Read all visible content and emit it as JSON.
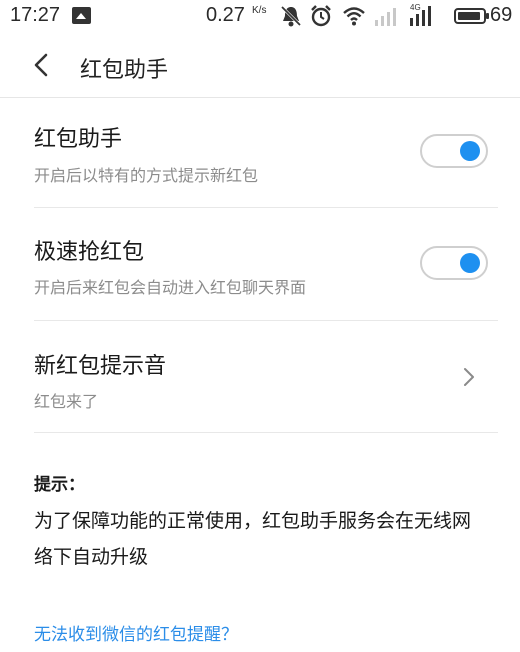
{
  "status_bar": {
    "time": "17:27",
    "net_speed": "0.27",
    "net_speed_unit": "K/s",
    "network_label": "4G",
    "battery_level": "69",
    "icons": [
      "notification-icon",
      "mute-icon",
      "alarm-icon",
      "wifi-icon",
      "signal-icon",
      "signal-4g-icon",
      "battery-icon"
    ]
  },
  "header": {
    "title": "红包助手"
  },
  "settings": [
    {
      "title": "红包助手",
      "subtitle": "开启后以特有的方式提示新红包",
      "control": "toggle",
      "enabled": true
    },
    {
      "title": "极速抢红包",
      "subtitle": "开启后来红包会自动进入红包聊天界面",
      "control": "toggle",
      "enabled": true
    },
    {
      "title": "新红包提示音",
      "subtitle": "红包来了",
      "control": "chevron"
    }
  ],
  "tips": {
    "heading": "提示：",
    "body": "为了保障功能的正常使用，红包助手服务会在无线网络下自动升级"
  },
  "help_link": "无法收到微信的红包提醒？",
  "colors": {
    "accent": "#1e90f0",
    "link": "#2b8de8",
    "subtitle": "#8c8c8c",
    "divider": "#e8e8e8"
  }
}
